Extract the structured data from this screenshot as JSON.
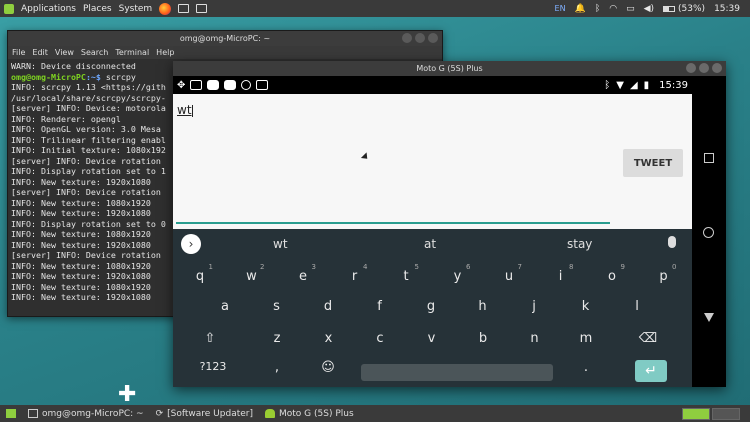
{
  "top_panel": {
    "menus": [
      "Applications",
      "Places",
      "System"
    ],
    "keyboard_layout": "EN",
    "battery": "(53%)",
    "time": "15:39"
  },
  "terminal": {
    "title": "omg@omg-MicroPC: ~",
    "menu": [
      "File",
      "Edit",
      "View",
      "Search",
      "Terminal",
      "Help"
    ],
    "lines": [
      "WARN: Device disconnected",
      "__PROMPT__",
      "INFO: scrcpy 1.13 <https://gith",
      "/usr/local/share/scrcpy/scrcpy-",
      "[server] INFO: Device: motorola",
      "INFO: Renderer: opengl",
      "INFO: OpenGL version: 3.0 Mesa",
      "INFO: Trilinear filtering enabl",
      "INFO: Initial texture: 1080x192",
      "[server] INFO: Device rotation",
      "INFO: Display rotation set to 1",
      "INFO: New texture: 1920x1080",
      "[server] INFO: Device rotation",
      "INFO: New texture: 1080x1920",
      "INFO: New texture: 1920x1080",
      "INFO: Display rotation set to 0",
      "INFO: New texture: 1080x1920",
      "INFO: New texture: 1920x1080",
      "[server] INFO: Device rotation",
      "INFO: New texture: 1080x1920",
      "INFO: New texture: 1920x1080",
      "INFO: New texture: 1080x1920",
      "INFO: New texture: 1920x1080"
    ],
    "prompt_user": "omg@omg-MicroPC",
    "prompt_path": ":~$",
    "prompt_cmd": " scrcpy"
  },
  "scrcpy": {
    "title": "Moto G (5S) Plus",
    "status_time": "15:39",
    "tweet_text": "wt",
    "tweet_button": "TWEET",
    "suggestions": [
      "wt",
      "at",
      "stay"
    ],
    "row1": [
      "q",
      "w",
      "e",
      "r",
      "t",
      "y",
      "u",
      "i",
      "o",
      "p"
    ],
    "row1_nums": [
      "1",
      "2",
      "3",
      "4",
      "5",
      "6",
      "7",
      "8",
      "9",
      "0"
    ],
    "row2": [
      "a",
      "s",
      "d",
      "f",
      "g",
      "h",
      "j",
      "k",
      "l"
    ],
    "row3": [
      "z",
      "x",
      "c",
      "v",
      "b",
      "n",
      "m"
    ],
    "symbols_key": "?123",
    "comma_key": ",",
    "period_key": "."
  },
  "taskbar": {
    "items": [
      "omg@omg-MicroPC: ~",
      "[Software Updater]",
      "Moto G (5S) Plus"
    ]
  },
  "colors": {
    "accent": "#2a9d8f",
    "keyboard_bg": "#263238",
    "enter_key": "#80cbc4"
  }
}
